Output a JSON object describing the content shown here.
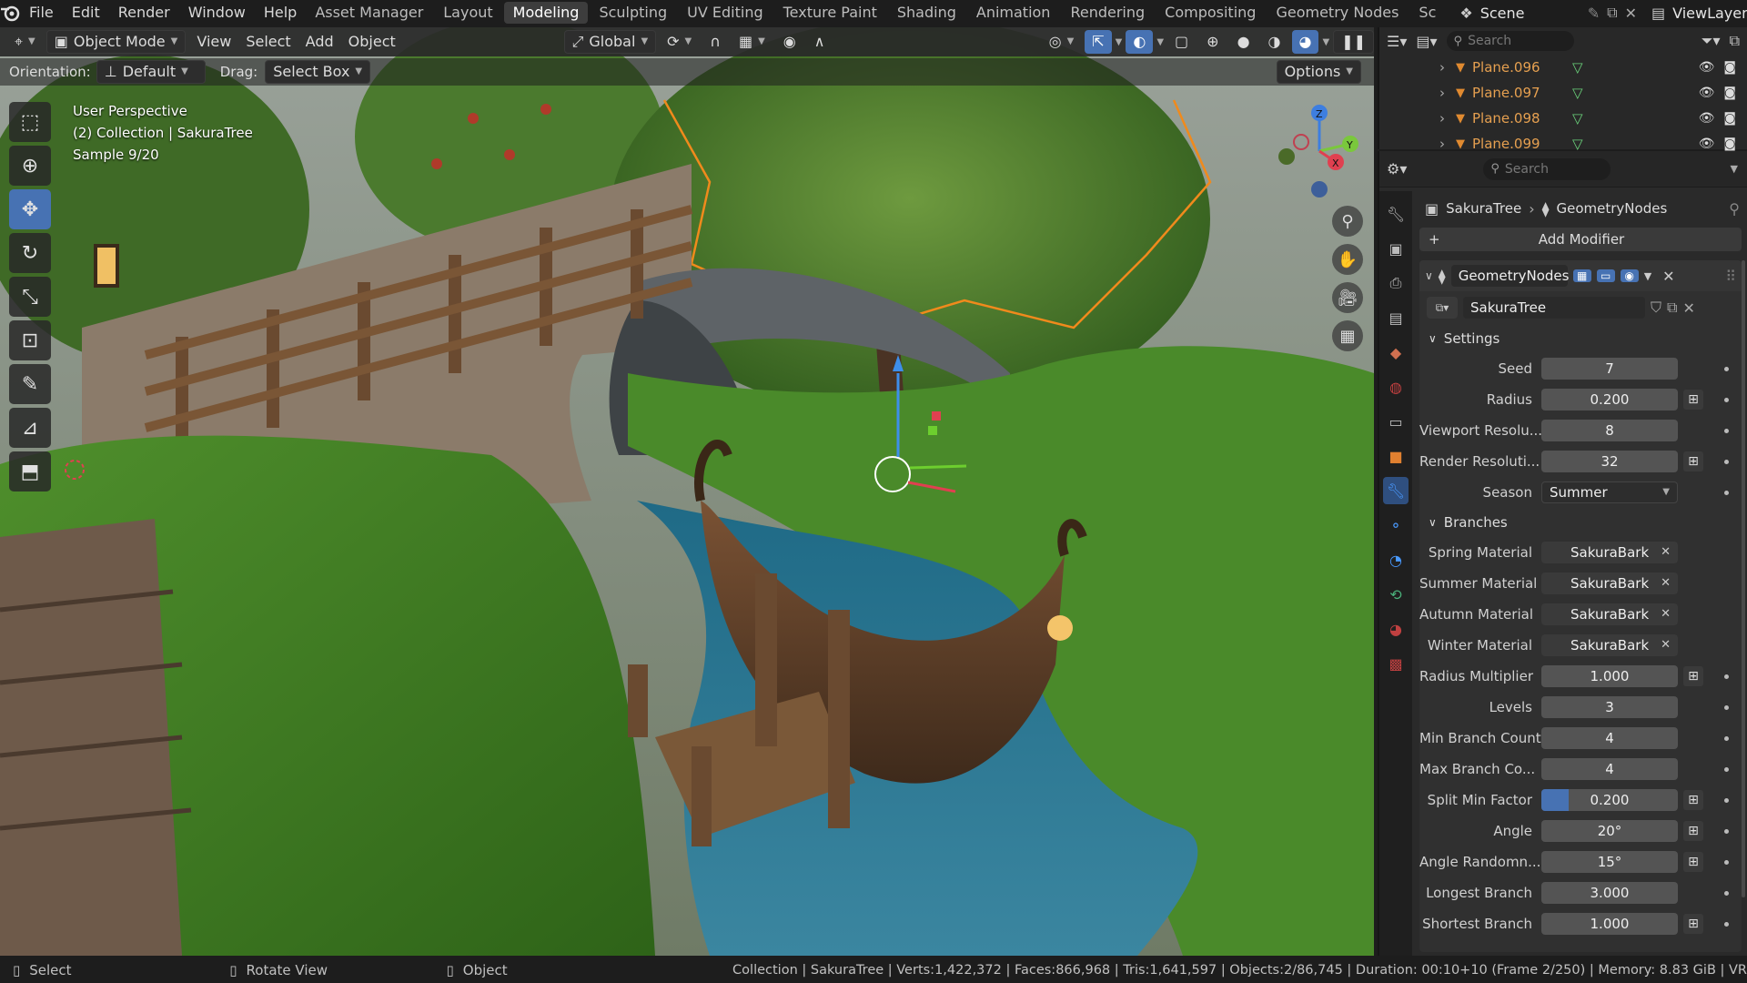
{
  "menu": [
    "File",
    "Edit",
    "Render",
    "Window",
    "Help"
  ],
  "workspaces": [
    {
      "label": "Asset Manager",
      "active": false
    },
    {
      "label": "Layout",
      "active": false
    },
    {
      "label": "Modeling",
      "active": true
    },
    {
      "label": "Sculpting",
      "active": false
    },
    {
      "label": "UV Editing",
      "active": false
    },
    {
      "label": "Texture Paint",
      "active": false
    },
    {
      "label": "Shading",
      "active": false
    },
    {
      "label": "Animation",
      "active": false
    },
    {
      "label": "Rendering",
      "active": false
    },
    {
      "label": "Compositing",
      "active": false
    },
    {
      "label": "Geometry Nodes",
      "active": false
    },
    {
      "label": "Sc",
      "active": false
    }
  ],
  "scene": "Scene",
  "view_layer": "ViewLayer",
  "viewport_header": {
    "mode": "Object Mode",
    "menus": [
      "View",
      "Select",
      "Add",
      "Object"
    ],
    "transform_orientation": "Global"
  },
  "viewport_sub": {
    "orientation_label": "Orientation:",
    "orientation_value": "Default",
    "drag_label": "Drag:",
    "drag_value": "Select Box",
    "options": "Options"
  },
  "overlay": {
    "line1": "User Perspective",
    "line2": "(2) Collection | SakuraTree",
    "line3": "Sample 9/20"
  },
  "outliner": {
    "search_placeholder": "Search",
    "items": [
      "Plane.096",
      "Plane.097",
      "Plane.098",
      "Plane.099"
    ]
  },
  "properties": {
    "search_placeholder": "Search",
    "breadcrumb_object": "SakuraTree",
    "breadcrumb_modifier": "GeometryNodes",
    "add_modifier": "Add Modifier",
    "modifier_name": "GeometryNodes",
    "node_group": "SakuraTree",
    "settings_label": "Settings",
    "branches_label": "Branches",
    "settings": [
      {
        "label": "Seed",
        "value": "7",
        "plus": false
      },
      {
        "label": "Radius",
        "value": "0.200",
        "plus": true
      },
      {
        "label": "Viewport Resolu...",
        "value": "8",
        "plus": false
      },
      {
        "label": "Render Resoluti...",
        "value": "32",
        "plus": true
      }
    ],
    "season_label": "Season",
    "season_value": "Summer",
    "materials": [
      {
        "label": "Spring Material",
        "value": "SakuraBark"
      },
      {
        "label": "Summer Material",
        "value": "SakuraBark"
      },
      {
        "label": "Autumn Material",
        "value": "SakuraBark"
      },
      {
        "label": "Winter Material",
        "value": "SakuraBark"
      }
    ],
    "branches": [
      {
        "label": "Radius Multiplier",
        "value": "1.000",
        "plus": true,
        "fill": 0
      },
      {
        "label": "Levels",
        "value": "3",
        "plus": false,
        "fill": 0
      },
      {
        "label": "Min Branch Count",
        "value": "4",
        "plus": false,
        "fill": 0
      },
      {
        "label": "Max Branch Co...",
        "value": "4",
        "plus": false,
        "fill": 0
      },
      {
        "label": "Split Min Factor",
        "value": "0.200",
        "plus": true,
        "fill": 0.2
      },
      {
        "label": "Angle",
        "value": "20°",
        "plus": true,
        "fill": 0
      },
      {
        "label": "Angle Randomn...",
        "value": "15°",
        "plus": true,
        "fill": 0
      },
      {
        "label": "Longest Branch",
        "value": "3.000",
        "plus": false,
        "fill": 0
      },
      {
        "label": "Shortest Branch",
        "value": "1.000",
        "plus": true,
        "fill": 0
      }
    ]
  },
  "statusbar": {
    "select": "Select",
    "rotate": "Rotate View",
    "object": "Object",
    "stats": "Collection | SakuraTree | Verts:1,422,372 | Faces:866,968 | Tris:1,641,597 | Objects:2/86,745 | Duration: 00:10+10 (Frame 2/250) | Memory: 8.83 GiB | VR"
  }
}
